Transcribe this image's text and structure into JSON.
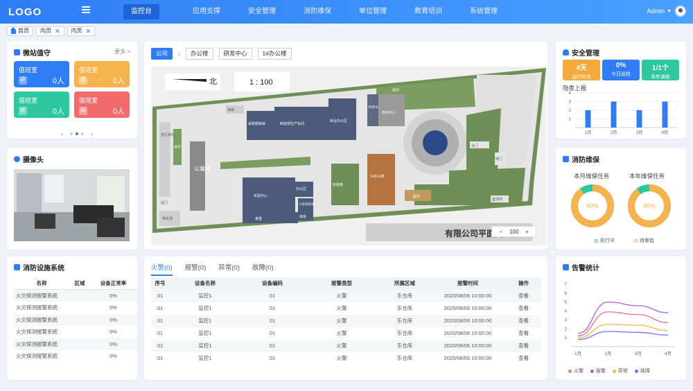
{
  "header": {
    "logo": "LOGO",
    "nav": [
      "监控台",
      "应用支撑",
      "安全管理",
      "消防维保",
      "单位管理",
      "教育培训",
      "系统管理"
    ],
    "user": "Admin"
  },
  "tabs": [
    {
      "label": "首页",
      "closable": false
    },
    {
      "label": "内页",
      "closable": true
    },
    {
      "label": "内页",
      "closable": true
    }
  ],
  "duty": {
    "title": "微站值守",
    "more": "更多 >",
    "items": [
      {
        "title": "值班室",
        "badge": "研",
        "count": "0人",
        "color": "#2f7df6"
      },
      {
        "title": "值班室",
        "badge": "研",
        "count": "0人",
        "color": "#f6b34d"
      },
      {
        "title": "值班室",
        "badge": "研",
        "count": "0人",
        "color": "#2ec8a0"
      },
      {
        "title": "值班室",
        "badge": "研",
        "count": "0人",
        "color": "#f46b6b"
      }
    ]
  },
  "camera": {
    "title": "摄像头"
  },
  "facility": {
    "title": "消防设施系统",
    "headers": [
      "名称",
      "区域",
      "设备正常率"
    ],
    "rows": [
      [
        "火灾探测报警系统",
        "",
        "0%"
      ],
      [
        "火灾探测报警系统",
        "",
        "0%"
      ],
      [
        "火灾探测报警系统",
        "",
        "0%"
      ],
      [
        "火灾探测报警系统",
        "",
        "0%"
      ],
      [
        "火灾探测报警系统",
        "",
        "0%"
      ],
      [
        "火灾探测报警系统",
        "",
        "0%"
      ]
    ]
  },
  "map": {
    "breadcrumb": [
      "公司",
      "办公楼",
      "研发中心",
      "1#办公楼"
    ],
    "north": "北",
    "scale": "1 : 100",
    "caption": "有限公司平面图",
    "zoom": "100",
    "labels": [
      "公寓楼",
      "自行车停放区",
      "草坪",
      "采购部库房",
      "制造部生产车间",
      "综合办公区",
      "2#办公楼",
      "培训中心",
      "库房",
      "大门",
      "实验中心",
      "办公区",
      "1#办公楼",
      "食堂",
      "库房",
      "实验楼",
      "小车停车场",
      "后门",
      "篮球场",
      "侧门",
      "超市",
      "草坪",
      "停车场"
    ]
  },
  "alarms": {
    "tabs": [
      "火警(0)",
      "报警(0)",
      "异常(0)",
      "故障(0)"
    ],
    "headers": [
      "序号",
      "设备名称",
      "设备编码",
      "报警类型",
      "所属区域",
      "报警时间",
      "操作"
    ],
    "rows": [
      [
        "01",
        "监控1",
        "01",
        "火警",
        "东仓库",
        "2020/08/06 10:00:00",
        "查看"
      ],
      [
        "01",
        "监控1",
        "01",
        "火警",
        "东仓库",
        "2020/08/06 10:00:00",
        "查看"
      ],
      [
        "01",
        "监控1",
        "01",
        "火警",
        "东仓库",
        "2020/08/06 10:00:00",
        "查看"
      ],
      [
        "01",
        "监控1",
        "01",
        "火警",
        "东仓库",
        "2020/08/06 10:00:00",
        "查看"
      ],
      [
        "01",
        "监控1",
        "01",
        "火警",
        "东仓库",
        "2020/08/06 10:00:00",
        "查看"
      ],
      [
        "01",
        "监控1",
        "01",
        "火警",
        "东仓库",
        "2020/08/06 10:00:00",
        "查看"
      ]
    ]
  },
  "safety": {
    "title": "安全管理",
    "stats": [
      {
        "value": "4天",
        "label": "运行时长",
        "color": "#f6a93b"
      },
      {
        "value": "0%",
        "label": "今日巡检",
        "color": "#2f7df6"
      },
      {
        "value": "1/1个",
        "label": "本年演练",
        "color": "#2ec8a0"
      }
    ],
    "subtitle": "隐患上报"
  },
  "maint": {
    "title": "消防维保",
    "left": "本月维保任务",
    "right": "本年维保任务",
    "left_value": "90%",
    "right_value": "90%",
    "legend": [
      "执行中",
      "待审批"
    ]
  },
  "alarmstat": {
    "title": "告警统计",
    "legend": [
      "火警",
      "报警",
      "异常",
      "故障"
    ]
  },
  "chart_data": [
    {
      "type": "bar",
      "title": "隐患上报",
      "categories": [
        "1月",
        "2月",
        "3月",
        "4月"
      ],
      "values": [
        2,
        3,
        2,
        3
      ],
      "yticks": [
        1,
        2,
        3,
        4
      ],
      "ylim": [
        0,
        4
      ]
    },
    {
      "type": "pie",
      "title": "本月维保任务",
      "labels": [
        "执行中",
        "待审批"
      ],
      "values": [
        10,
        90
      ],
      "center_label": "90%"
    },
    {
      "type": "pie",
      "title": "本年维保任务",
      "labels": [
        "执行中",
        "待审批"
      ],
      "values": [
        10,
        90
      ],
      "center_label": "90%"
    },
    {
      "type": "line",
      "title": "告警统计",
      "x": [
        "1月",
        "2月",
        "3月",
        "4月"
      ],
      "yticks": [
        1,
        2,
        3,
        4,
        5,
        6,
        7
      ],
      "ylim": [
        0,
        7
      ],
      "series": [
        {
          "name": "火警",
          "color": "#f46b8c",
          "values": [
            1.2,
            3.9,
            3.6,
            2.7
          ]
        },
        {
          "name": "报警",
          "color": "#b05ce6",
          "values": [
            1.5,
            5.0,
            4.6,
            3.8
          ]
        },
        {
          "name": "异常",
          "color": "#f6b34d",
          "values": [
            1.0,
            2.5,
            2.4,
            1.8
          ]
        },
        {
          "name": "故障",
          "color": "#7a6cf0",
          "values": [
            0.8,
            1.7,
            1.6,
            1.3
          ]
        }
      ]
    }
  ]
}
